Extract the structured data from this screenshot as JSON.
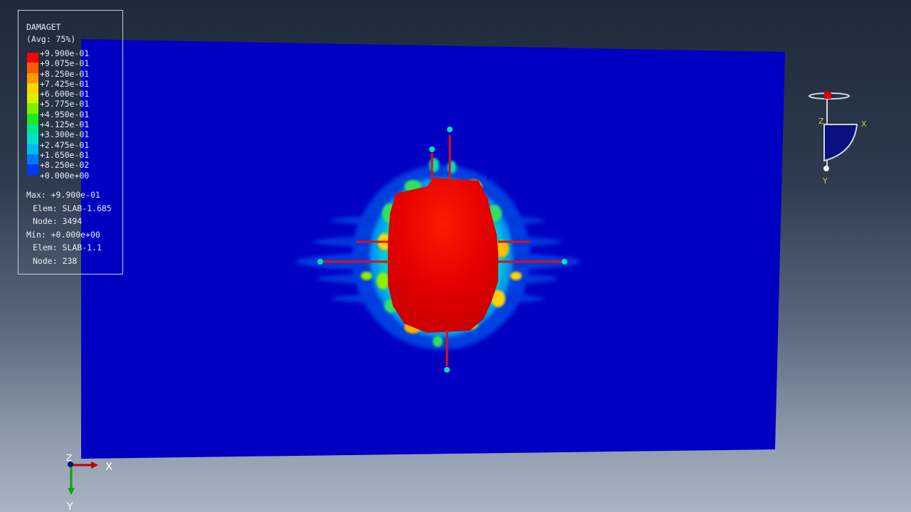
{
  "legend": {
    "variable": "DAMAGET",
    "averaging": "(Avg: 75%)",
    "ticks": [
      "+9.900e-01",
      "+9.075e-01",
      "+8.250e-01",
      "+7.425e-01",
      "+6.600e-01",
      "+5.775e-01",
      "+4.950e-01",
      "+4.125e-01",
      "+3.300e-01",
      "+2.475e-01",
      "+1.650e-01",
      "+8.250e-02",
      "+0.000e+00"
    ],
    "colors": [
      "#ff0000",
      "#ff5a00",
      "#ff9a00",
      "#ffd200",
      "#d8f000",
      "#80ef00",
      "#1eea1e",
      "#00e88a",
      "#00e0d0",
      "#00b8f2",
      "#0078ff",
      "#0038ff",
      "#0000c8"
    ],
    "max": {
      "value": "Max: +9.900e-01",
      "elem": "Elem: SLAB-1.685",
      "node": "Node: 3494"
    },
    "min": {
      "value": "Min: +0.000e+00",
      "elem": "Elem: SLAB-1.1",
      "node": "Node: 238"
    }
  },
  "view_triad": {
    "x": "X",
    "y": "Y",
    "z": "Z"
  },
  "global_triad": {
    "x": "X",
    "y": "Y",
    "z": "Z"
  },
  "colors": {
    "slab": "#0000c3",
    "damage_max": "#ff0000"
  }
}
